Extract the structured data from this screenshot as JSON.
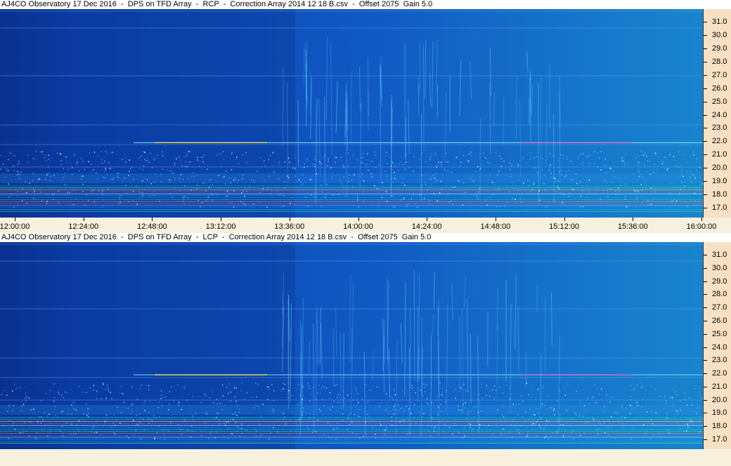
{
  "panels": [
    {
      "title": "AJ4CO Observatory 17 Dec 2016  -  DPS on TFD Array  -  RCP  -  Correction Array 2014 12 18 B.csv  -  Offset 2075  Gain 5.0",
      "freq_labels": [
        "31.0",
        "30.0",
        "29.0",
        "28.0",
        "27.0",
        "26.0",
        "25.0",
        "24.0",
        "23.0",
        "22.0",
        "21.0",
        "20.0",
        "19.0",
        "18.0",
        "17.0"
      ],
      "time_labels": [
        "12:00:00",
        "12:24:00",
        "12:48:00",
        "13:12:00",
        "13:36:00",
        "14:00:00",
        "14:24:00",
        "14:48:00",
        "15:12:00",
        "15:36:00",
        "16:00:00"
      ]
    },
    {
      "title": "AJ4CO Observatory 17 Dec 2016  -  DPS on TFD Array  -  LCP  -  Correction Array 2014 12 18 B.csv  -  Offset 2075  Gain 5.0",
      "freq_labels": [
        "31.0",
        "30.0",
        "29.0",
        "28.0",
        "27.0",
        "26.0",
        "25.0",
        "24.0",
        "23.0",
        "22.0",
        "21.0",
        "20.0",
        "19.0",
        "18.0",
        "17.0"
      ],
      "time_labels": []
    }
  ],
  "colors": {
    "background": "#f7f0dc",
    "spectrogram_low": "#0b3fa8",
    "spectrogram_high": "#1fa7ec",
    "scale_background": "#f7e0c4"
  }
}
